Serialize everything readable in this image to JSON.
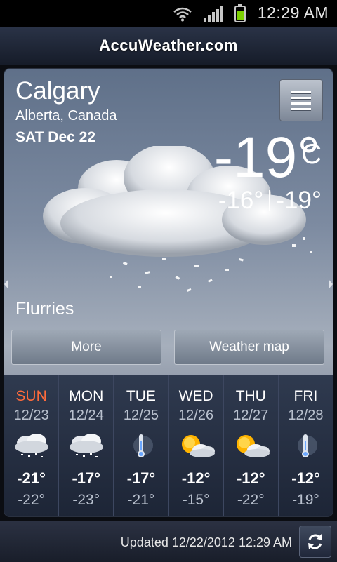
{
  "status_bar": {
    "time": "12:29 AM",
    "icons": [
      "wifi-icon",
      "signal-icon",
      "battery-icon"
    ],
    "battery_color": "#7bd000"
  },
  "header": {
    "title": "AccuWeather.com"
  },
  "current": {
    "city": "Calgary",
    "region": "Alberta, Canada",
    "date": "SAT Dec 22",
    "temperature": "-19°",
    "unit": "C",
    "high": "-16°",
    "low": "-19°",
    "condition": "Flurries",
    "icon": "flurries-cloud-icon"
  },
  "buttons": {
    "more": "More",
    "weather_map": "Weather map"
  },
  "forecast": [
    {
      "day": "SUN",
      "date": "12/23",
      "high": "-21°",
      "low": "-22°",
      "icon": "flurries-icon",
      "highlight": true
    },
    {
      "day": "MON",
      "date": "12/24",
      "high": "-17°",
      "low": "-23°",
      "icon": "flurries-icon",
      "highlight": false
    },
    {
      "day": "TUE",
      "date": "12/25",
      "high": "-17°",
      "low": "-21°",
      "icon": "cold-thermometer-icon",
      "highlight": false
    },
    {
      "day": "WED",
      "date": "12/26",
      "high": "-12°",
      "low": "-15°",
      "icon": "partly-sunny-icon",
      "highlight": false
    },
    {
      "day": "THU",
      "date": "12/27",
      "high": "-12°",
      "low": "-22°",
      "icon": "partly-sunny-icon",
      "highlight": false
    },
    {
      "day": "FRI",
      "date": "12/28",
      "high": "-12°",
      "low": "-19°",
      "icon": "cold-thermometer-icon",
      "highlight": false
    }
  ],
  "footer": {
    "updated": "Updated 12/22/2012 12:29 AM"
  },
  "colors": {
    "today": "#ff6b3b",
    "accent_sun": "#ffb400"
  }
}
